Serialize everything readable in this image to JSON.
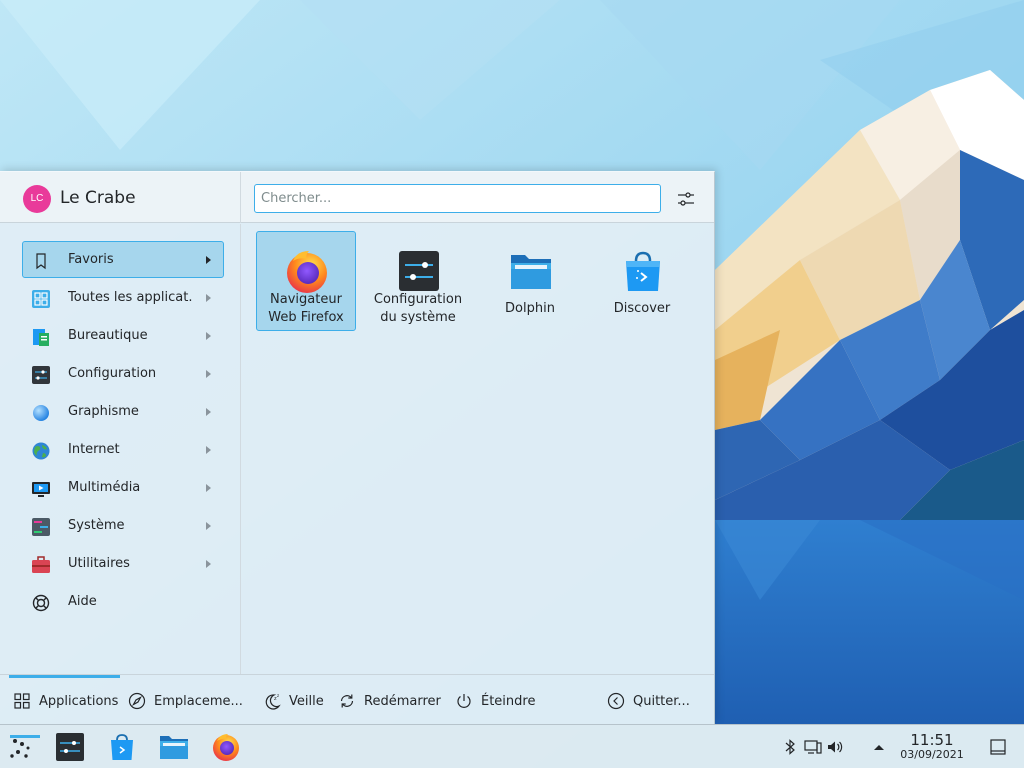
{
  "user": {
    "initials": "LC",
    "name": "Le Crabe"
  },
  "search": {
    "placeholder": "Chercher..."
  },
  "sidebar": {
    "items": [
      {
        "label": "Favoris",
        "icon": "bookmark-icon"
      },
      {
        "label": "Toutes les applicat...",
        "icon": "grid-icon"
      },
      {
        "label": "Bureautique",
        "icon": "office-icon"
      },
      {
        "label": "Configuration",
        "icon": "settings-icon"
      },
      {
        "label": "Graphisme",
        "icon": "graphics-icon"
      },
      {
        "label": "Internet",
        "icon": "globe-icon"
      },
      {
        "label": "Multimédia",
        "icon": "multimedia-icon"
      },
      {
        "label": "Système",
        "icon": "system-icon"
      },
      {
        "label": "Utilitaires",
        "icon": "toolbox-icon"
      },
      {
        "label": "Aide",
        "icon": "lifebuoy-icon"
      }
    ]
  },
  "apps": [
    {
      "label": "Navigateur\nWeb Firefox",
      "icon": "firefox-icon"
    },
    {
      "label": "Configuration\ndu système",
      "icon": "system-settings-icon"
    },
    {
      "label": "Dolphin",
      "icon": "folder-icon"
    },
    {
      "label": "Discover",
      "icon": "store-icon"
    }
  ],
  "footer": {
    "applications": "Applications",
    "places": "Emplaceme...",
    "sleep": "Veille",
    "restart": "Redémarrer",
    "shutdown": "Éteindre",
    "quit": "Quitter..."
  },
  "clock": {
    "time": "11:51",
    "date": "03/09/2021"
  },
  "colors": {
    "accent": "#3daee9",
    "avatar": "#e93a9a"
  }
}
